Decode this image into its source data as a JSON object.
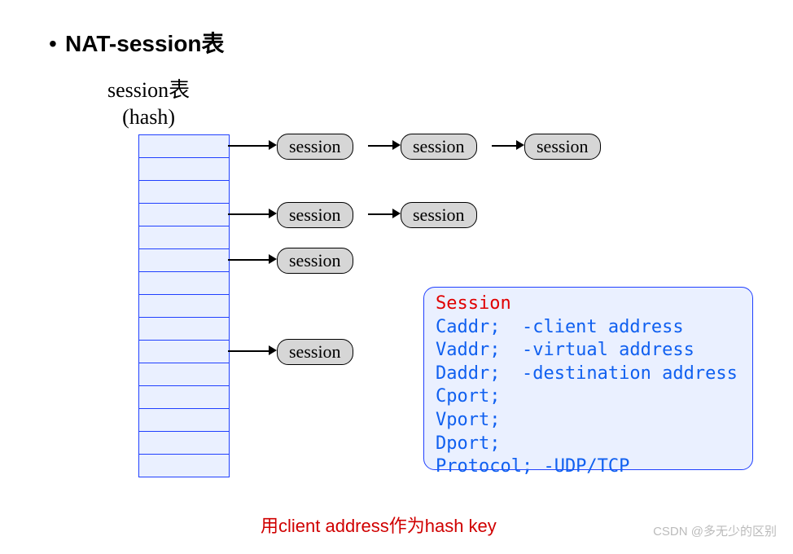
{
  "title": "NAT-session表",
  "hash_label_l1": "session表",
  "hash_label_l2": "(hash)",
  "hash_rows": 15,
  "chains": {
    "row0": [
      "session",
      "session",
      "session"
    ],
    "row3": [
      "session",
      "session"
    ],
    "row5": [
      "session"
    ],
    "row9": [
      "session"
    ]
  },
  "info": {
    "header": "Session",
    "lines": [
      "Caddr;  -client address",
      "Vaddr;  -virtual address",
      "Daddr;  -destination address",
      "Cport;",
      "Vport;",
      "Dport;",
      "Protocol; -UDP/TCP"
    ]
  },
  "footnote": "用client address作为hash key",
  "watermark": "CSDN @多无少的区别"
}
